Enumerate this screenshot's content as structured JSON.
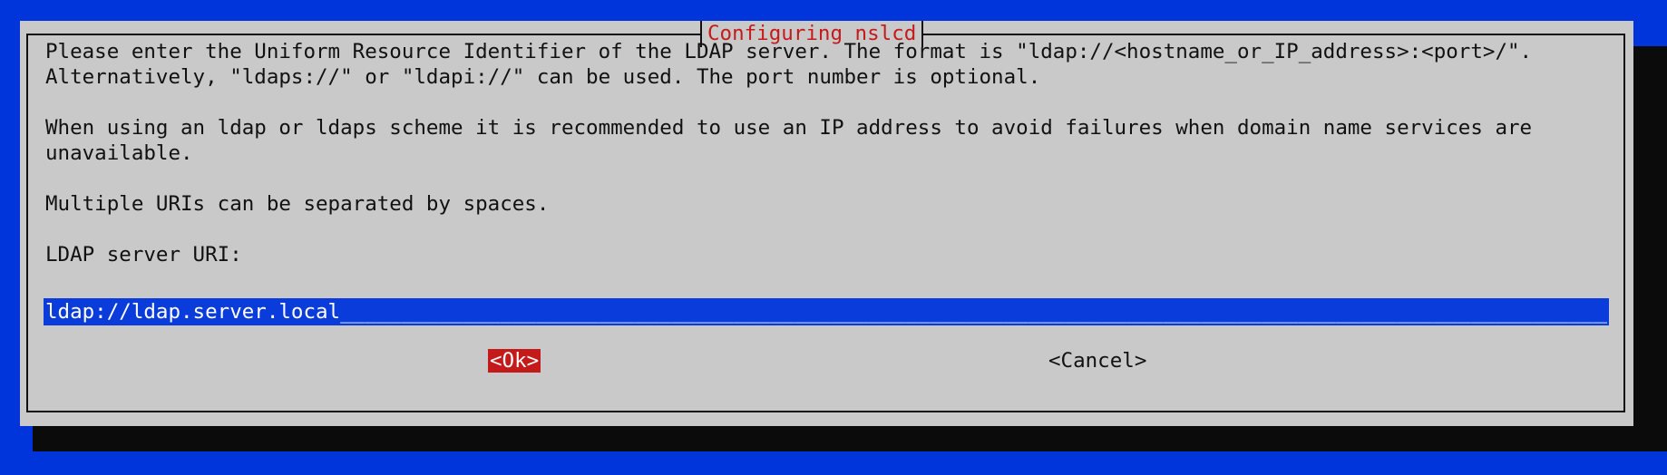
{
  "dialog": {
    "title": "Configuring nslcd",
    "paragraphs": {
      "p1_line1": "Please enter the Uniform Resource Identifier of the LDAP server. The format is \"ldap://<hostname_or_IP_address>:<port>/\".",
      "p1_line2": "Alternatively, \"ldaps://\" or \"ldapi://\" can be used. The port number is optional.",
      "p2_line1": "When using an ldap or ldaps scheme it is recommended to use an IP address to avoid failures when domain name services are",
      "p2_line2": "unavailable.",
      "p3_line1": "Multiple URIs can be separated by spaces."
    },
    "field_label": "LDAP server URI:",
    "input": {
      "value": "ldap://ldap.server.local",
      "fill": "_______________________________________________________________________________________________________________________"
    },
    "buttons": {
      "ok": "<Ok>",
      "cancel": "<Cancel>"
    }
  },
  "colors": {
    "background": "#0035dc",
    "dialog": "#c9c9c9",
    "title_text": "#c51a1a",
    "input_bg": "#0a3cdc",
    "ok_button_bg": "#c51a1a",
    "shadow": "#0b0b0b"
  }
}
